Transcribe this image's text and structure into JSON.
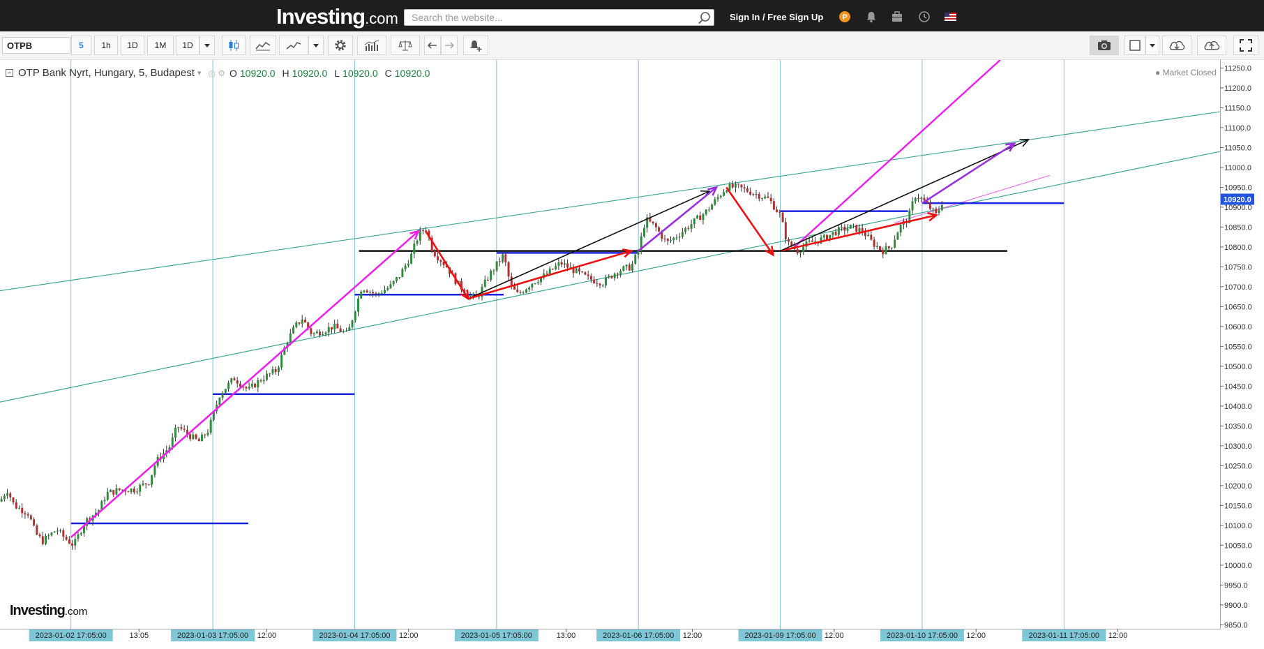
{
  "header": {
    "logo_main": "Investing",
    "logo_suffix": ".com",
    "search_placeholder": "Search the website...",
    "signin_label": "Sign In / Free Sign Up"
  },
  "toolbar": {
    "symbol": "OTPB",
    "intervals": [
      "5",
      "1h",
      "1D",
      "1M",
      "1D"
    ],
    "active_interval": "5"
  },
  "chart_info": {
    "name": "OTP Bank Nyrt, Hungary, 5, Budapest",
    "open": "10920.0",
    "high": "10920.0",
    "low": "10920.0",
    "close": "10920.0",
    "status": "Market Closed",
    "current_price_label": "10920.0",
    "watermark_main": "Investing",
    "watermark_suffix": ".com"
  },
  "chart_data": {
    "type": "candlestick",
    "y_ticks": [
      11250,
      11200,
      11150,
      11100,
      11050,
      11000,
      10950,
      10900,
      10850,
      10800,
      10750,
      10700,
      10650,
      10600,
      10550,
      10500,
      10450,
      10400,
      10350,
      10300,
      10250,
      10200,
      10150,
      10100,
      10050,
      10000,
      9950,
      9900,
      9850
    ],
    "ylim": [
      9840,
      11270
    ],
    "x_labels": [
      {
        "t": 0.5,
        "label": "2023-01-02 17:05:00",
        "highlight": true
      },
      {
        "t": 0.98,
        "label": "13:05",
        "highlight": false
      },
      {
        "t": 1.5,
        "label": "2023-01-03 17:05:00",
        "highlight": true
      },
      {
        "t": 1.88,
        "label": "12:00",
        "highlight": false
      },
      {
        "t": 2.5,
        "label": "2023-01-04 17:05:00",
        "highlight": true
      },
      {
        "t": 2.88,
        "label": "12:00",
        "highlight": false
      },
      {
        "t": 3.5,
        "label": "2023-01-05 17:05:00",
        "highlight": true
      },
      {
        "t": 3.99,
        "label": "13:00",
        "highlight": false
      },
      {
        "t": 4.5,
        "label": "2023-01-06 17:05:00",
        "highlight": true
      },
      {
        "t": 4.88,
        "label": "12:00",
        "highlight": false
      },
      {
        "t": 5.5,
        "label": "2023-01-09 17:05:00",
        "highlight": true
      },
      {
        "t": 5.88,
        "label": "12:00",
        "highlight": false
      },
      {
        "t": 6.5,
        "label": "2023-01-10 17:05:00",
        "highlight": true
      },
      {
        "t": 6.88,
        "label": "12:00",
        "highlight": false
      },
      {
        "t": 7.5,
        "label": "2023-01-11 17:05:00",
        "highlight": true
      },
      {
        "t": 7.88,
        "label": "12:00",
        "highlight": false
      }
    ],
    "x_time_range": [
      0,
      8.6
    ],
    "vertical_gridlines": [
      0.5,
      1.5,
      2.5,
      3.5,
      4.5,
      5.5,
      6.5,
      7.5
    ],
    "price_path": [
      [
        0.0,
        10160
      ],
      [
        0.05,
        10190
      ],
      [
        0.1,
        10150
      ],
      [
        0.2,
        10130
      ],
      [
        0.25,
        10080
      ],
      [
        0.3,
        10060
      ],
      [
        0.4,
        10090
      ],
      [
        0.45,
        10070
      ],
      [
        0.52,
        10050
      ],
      [
        0.6,
        10110
      ],
      [
        0.7,
        10140
      ],
      [
        0.75,
        10180
      ],
      [
        0.85,
        10190
      ],
      [
        0.95,
        10190
      ],
      [
        1.05,
        10210
      ],
      [
        1.1,
        10260
      ],
      [
        1.2,
        10300
      ],
      [
        1.25,
        10350
      ],
      [
        1.32,
        10330
      ],
      [
        1.4,
        10310
      ],
      [
        1.47,
        10340
      ],
      [
        1.55,
        10430
      ],
      [
        1.65,
        10470
      ],
      [
        1.75,
        10440
      ],
      [
        1.85,
        10470
      ],
      [
        1.95,
        10490
      ],
      [
        2.02,
        10560
      ],
      [
        2.08,
        10600
      ],
      [
        2.13,
        10620
      ],
      [
        2.2,
        10580
      ],
      [
        2.28,
        10590
      ],
      [
        2.35,
        10600
      ],
      [
        2.45,
        10580
      ],
      [
        2.5,
        10640
      ],
      [
        2.55,
        10700
      ],
      [
        2.65,
        10680
      ],
      [
        2.75,
        10700
      ],
      [
        2.82,
        10730
      ],
      [
        2.9,
        10780
      ],
      [
        2.95,
        10830
      ],
      [
        3.0,
        10850
      ],
      [
        3.05,
        10790
      ],
      [
        3.15,
        10750
      ],
      [
        3.22,
        10710
      ],
      [
        3.3,
        10680
      ],
      [
        3.36,
        10670
      ],
      [
        3.45,
        10730
      ],
      [
        3.55,
        10780
      ],
      [
        3.6,
        10700
      ],
      [
        3.65,
        10680
      ],
      [
        3.75,
        10710
      ],
      [
        3.85,
        10730
      ],
      [
        3.95,
        10760
      ],
      [
        4.05,
        10740
      ],
      [
        4.15,
        10720
      ],
      [
        4.25,
        10710
      ],
      [
        4.35,
        10740
      ],
      [
        4.45,
        10750
      ],
      [
        4.5,
        10790
      ],
      [
        4.55,
        10870
      ],
      [
        4.62,
        10850
      ],
      [
        4.7,
        10810
      ],
      [
        4.78,
        10830
      ],
      [
        4.88,
        10860
      ],
      [
        4.98,
        10890
      ],
      [
        5.05,
        10920
      ],
      [
        5.12,
        10950
      ],
      [
        5.2,
        10950
      ],
      [
        5.28,
        10940
      ],
      [
        5.35,
        10930
      ],
      [
        5.42,
        10920
      ],
      [
        5.5,
        10880
      ],
      [
        5.55,
        10810
      ],
      [
        5.62,
        10790
      ],
      [
        5.7,
        10810
      ],
      [
        5.8,
        10820
      ],
      [
        5.9,
        10840
      ],
      [
        6.0,
        10850
      ],
      [
        6.08,
        10840
      ],
      [
        6.15,
        10810
      ],
      [
        6.22,
        10790
      ],
      [
        6.28,
        10800
      ],
      [
        6.34,
        10850
      ],
      [
        6.4,
        10870
      ],
      [
        6.45,
        10930
      ],
      [
        6.5,
        10920
      ],
      [
        6.55,
        10900
      ],
      [
        6.6,
        10880
      ],
      [
        6.65,
        10920
      ]
    ],
    "drawings": {
      "horizontal_lines": [
        {
          "color": "#1a22e0",
          "t1": 0.5,
          "t2": 1.75,
          "price": 10105
        },
        {
          "color": "#1a22e0",
          "t1": 1.5,
          "t2": 2.5,
          "price": 10430
        },
        {
          "color": "#1a22e0",
          "t1": 2.5,
          "t2": 3.55,
          "price": 10680
        },
        {
          "color": "#1a22e0",
          "t1": 3.5,
          "t2": 4.5,
          "price": 10785
        },
        {
          "color": "#1a22e0",
          "t1": 5.5,
          "t2": 6.4,
          "price": 10890
        },
        {
          "color": "#1a22e0",
          "t1": 6.5,
          "t2": 7.5,
          "price": 10910
        },
        {
          "color": "#111111",
          "t1": 2.53,
          "t2": 7.1,
          "price": 10790
        }
      ],
      "trend_lines": [
        {
          "color": "#3aa58f",
          "t1": 0.0,
          "p1": 10690,
          "t2": 8.6,
          "p2": 11140
        },
        {
          "color": "#3aa58f",
          "t1": 0.0,
          "p1": 10410,
          "t2": 8.6,
          "p2": 11040
        },
        {
          "color": "#ee22ee",
          "t1": 5.6,
          "p1": 10800,
          "t2": 7.05,
          "p2": 11270
        },
        {
          "color": "#f070f0",
          "t1": 6.3,
          "p1": 10860,
          "t2": 7.4,
          "p2": 10980
        }
      ],
      "arrows": [
        {
          "color": "#ee22ee",
          "points": [
            [
              0.5,
              10070
            ],
            [
              2.95,
              10840
            ]
          ]
        },
        {
          "color": "#ee1111",
          "points": [
            [
              3.0,
              10840
            ],
            [
              3.3,
              10670
            ]
          ]
        },
        {
          "color": "#111111",
          "points": [
            [
              3.3,
              10670
            ],
            [
              5.0,
              10940
            ]
          ]
        },
        {
          "color": "#ee1111",
          "points": [
            [
              3.3,
              10670
            ],
            [
              4.45,
              10790
            ]
          ]
        },
        {
          "color": "#9b30e0",
          "points": [
            [
              4.5,
              10790
            ],
            [
              5.05,
              10950
            ]
          ]
        },
        {
          "color": "#ee1111",
          "points": [
            [
              5.12,
              10950
            ],
            [
              5.45,
              10780
            ]
          ]
        },
        {
          "color": "#ee1111",
          "points": [
            [
              5.5,
              10790
            ],
            [
              6.6,
              10880
            ]
          ]
        },
        {
          "color": "#111111",
          "points": [
            [
              5.5,
              10790
            ],
            [
              7.25,
              11070
            ]
          ]
        },
        {
          "color": "#9b30e0",
          "points": [
            [
              6.5,
              10910
            ],
            [
              7.15,
              11060
            ]
          ]
        }
      ]
    }
  }
}
